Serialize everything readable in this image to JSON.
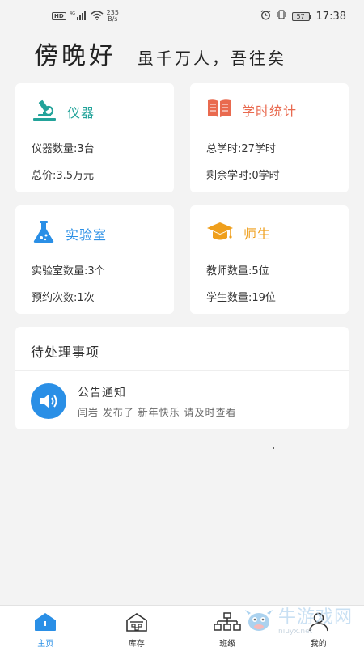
{
  "status_bar": {
    "hd": "HD",
    "signal_label": "4G",
    "speed_value": "235",
    "speed_unit": "B/s",
    "battery": "57",
    "time": "17:38"
  },
  "greeting": {
    "main": "傍晚好",
    "motto": "虽千万人，吾往矣"
  },
  "cards": {
    "instrument": {
      "title": "仪器",
      "line1": "仪器数量:3台",
      "line2": "总价:3.5万元",
      "color": "#23a39a"
    },
    "hours": {
      "title": "学时统计",
      "line1": "总学时:27学时",
      "line2": "剩余学时:0学时",
      "color": "#e96a4f"
    },
    "lab": {
      "title": "实验室",
      "line1": "实验室数量:3个",
      "line2": "预约次数:1次",
      "color": "#2a8fe6"
    },
    "people": {
      "title": "师生",
      "line1": "教师数量:5位",
      "line2": "学生数量:19位",
      "color": "#ef9f1c"
    }
  },
  "todo": {
    "title": "待处理事项",
    "notice_title": "公告通知",
    "notice_body": "闫岩 发布了 新年快乐 请及时查看"
  },
  "tabs": [
    {
      "label": "主页",
      "icon": "home-icon",
      "active": true
    },
    {
      "label": "库存",
      "icon": "warehouse-icon",
      "active": false
    },
    {
      "label": "班级",
      "icon": "org-chart-icon",
      "active": false
    },
    {
      "label": "我的",
      "icon": "person-icon",
      "active": false
    }
  ],
  "watermark": {
    "big": "牛游戏网",
    "small": "niuyx.net"
  },
  "colors": {
    "accent": "#2a8fe6",
    "background": "#f3f3f3"
  }
}
